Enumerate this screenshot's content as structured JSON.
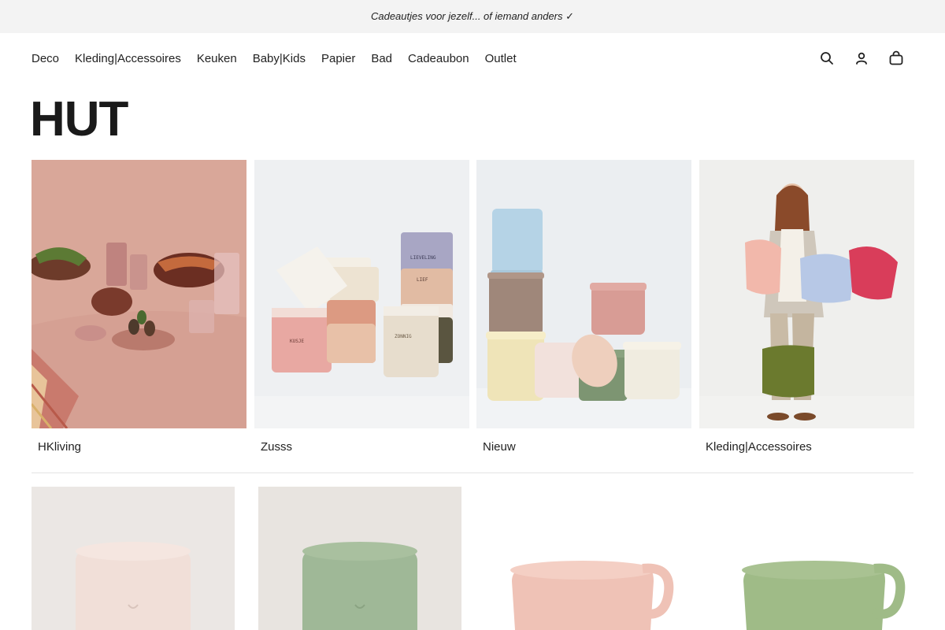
{
  "announcement": {
    "text": "Cadeautjes voor jezelf... of iemand anders ✓"
  },
  "nav": {
    "links": [
      "Deco",
      "Kleding|Accessoires",
      "Keuken",
      "Baby|Kids",
      "Papier",
      "Bad",
      "Cadeaubon",
      "Outlet"
    ],
    "icons": [
      "search-icon",
      "account-icon",
      "cart-icon"
    ]
  },
  "page": {
    "title": "HUT"
  },
  "collections": [
    {
      "label": "HKliving"
    },
    {
      "label": "Zusss"
    },
    {
      "label": "Nieuw"
    },
    {
      "label": "Kleding|Accessoires"
    }
  ],
  "colors": {
    "announcement_bg": "#f3f3f3",
    "text": "#1a1a1a",
    "divider": "#e4e4e4"
  }
}
